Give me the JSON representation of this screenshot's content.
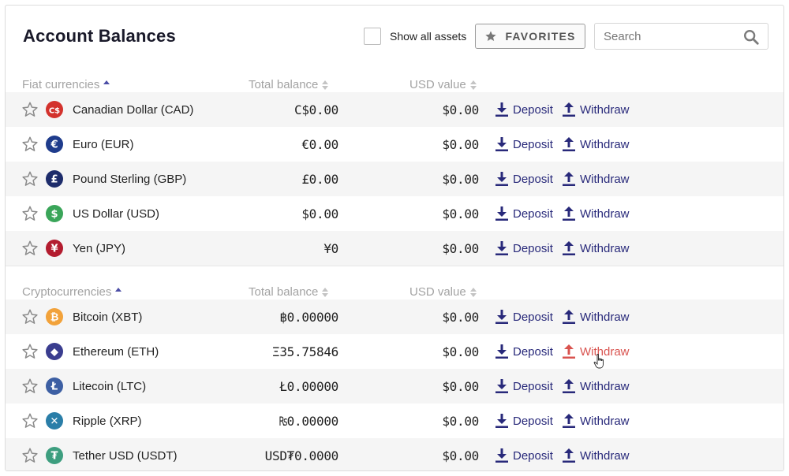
{
  "header": {
    "title": "Account Balances",
    "show_all_label": "Show all assets",
    "favorites_label": "FAVORITES",
    "search_placeholder": "Search"
  },
  "colors": {
    "link": "#28297a",
    "link_hover": "#d9534f",
    "row_alt": "#f5f5f5",
    "header_text": "#a3a3a3"
  },
  "fiat": {
    "columns": [
      "Fiat currencies",
      "Total balance",
      "USD value"
    ],
    "rows": [
      {
        "name": "Canadian Dollar (CAD)",
        "icon": "cad-icon",
        "symbol": "C$",
        "color": "#d3322d",
        "balance": "C$0.00",
        "usd": "$0.00",
        "deposit": "Deposit",
        "withdraw": "Withdraw"
      },
      {
        "name": "Euro (EUR)",
        "icon": "eur-icon",
        "symbol": "€",
        "color": "#1f3c8c",
        "balance": "€0.00",
        "usd": "$0.00",
        "deposit": "Deposit",
        "withdraw": "Withdraw"
      },
      {
        "name": "Pound Sterling (GBP)",
        "icon": "gbp-icon",
        "symbol": "£",
        "color": "#1d2c6b",
        "balance": "£0.00",
        "usd": "$0.00",
        "deposit": "Deposit",
        "withdraw": "Withdraw"
      },
      {
        "name": "US Dollar (USD)",
        "icon": "usd-icon",
        "symbol": "$",
        "color": "#3aa559",
        "balance": "$0.00",
        "usd": "$0.00",
        "deposit": "Deposit",
        "withdraw": "Withdraw"
      },
      {
        "name": "Yen (JPY)",
        "icon": "jpy-icon",
        "symbol": "¥",
        "color": "#b31c2f",
        "balance": "¥0",
        "usd": "$0.00",
        "deposit": "Deposit",
        "withdraw": "Withdraw"
      }
    ]
  },
  "crypto": {
    "columns": [
      "Cryptocurrencies",
      "Total balance",
      "USD value"
    ],
    "rows": [
      {
        "name": "Bitcoin (XBT)",
        "icon": "bitcoin-icon",
        "symbol": "₿",
        "color": "#f2a23a",
        "balance": "฿0.00000",
        "usd": "$0.00",
        "deposit": "Deposit",
        "withdraw": "Withdraw"
      },
      {
        "name": "Ethereum (ETH)",
        "icon": "ethereum-icon",
        "symbol": "◆",
        "color": "#3a3d8f",
        "balance": "Ξ35.75846",
        "usd": "$0.00",
        "deposit": "Deposit",
        "withdraw": "Withdraw"
      },
      {
        "name": "Litecoin (LTC)",
        "icon": "litecoin-icon",
        "symbol": "Ł",
        "color": "#3d5fa3",
        "balance": "Ł0.00000",
        "usd": "$0.00",
        "deposit": "Deposit",
        "withdraw": "Withdraw"
      },
      {
        "name": "Ripple (XRP)",
        "icon": "ripple-icon",
        "symbol": "✕",
        "color": "#2a7ea8",
        "balance": "₨0.00000",
        "usd": "$0.00",
        "deposit": "Deposit",
        "withdraw": "Withdraw"
      },
      {
        "name": "Tether USD (USDT)",
        "icon": "tether-icon",
        "symbol": "₮",
        "color": "#3d9e7f",
        "balance": "USD₮0.0000",
        "usd": "$0.00",
        "deposit": "Deposit",
        "withdraw": "Withdraw"
      }
    ]
  }
}
